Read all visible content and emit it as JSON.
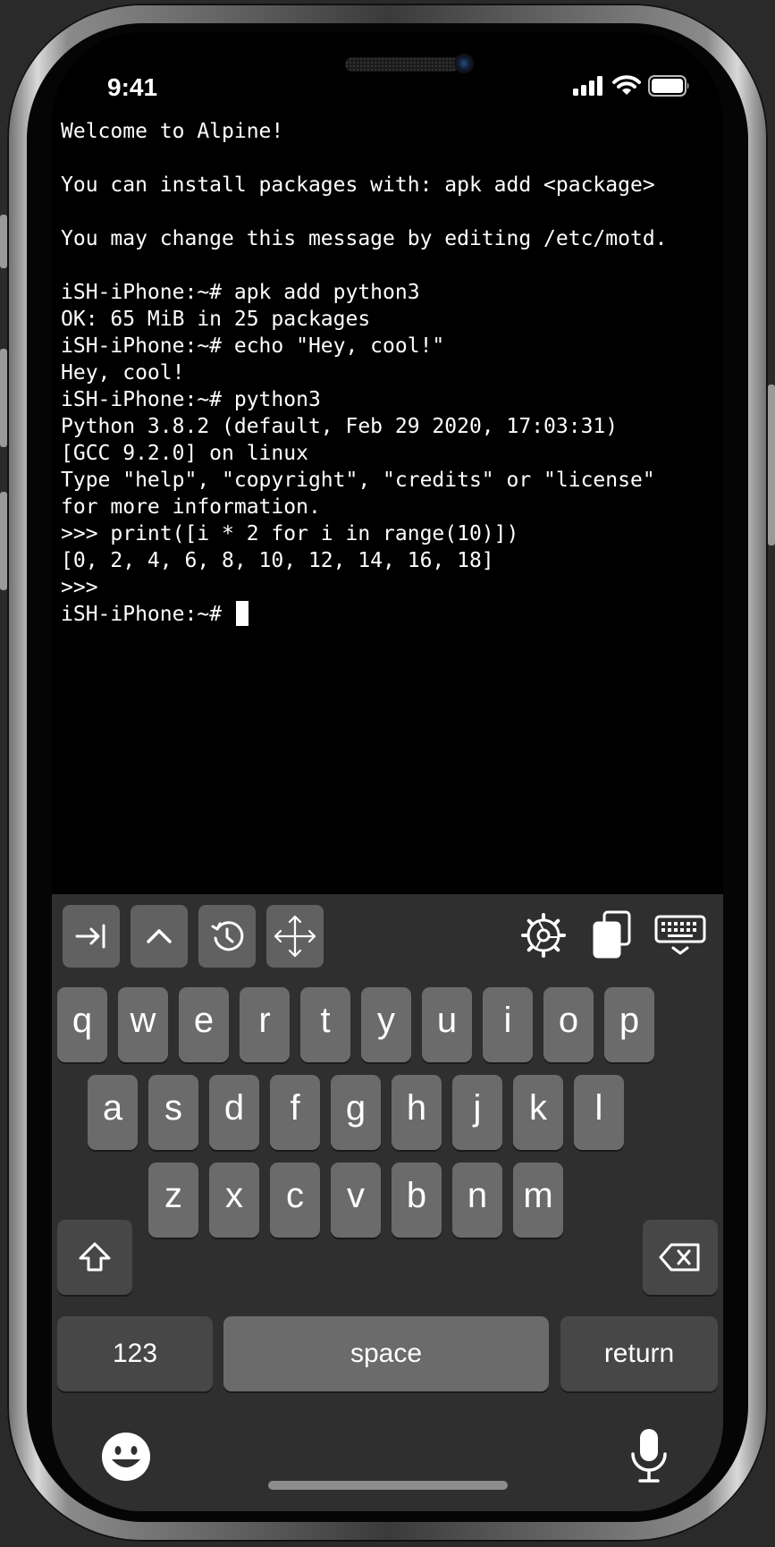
{
  "status_bar": {
    "time": "9:41",
    "icons": [
      "cellular-signal-icon",
      "wifi-icon",
      "battery-icon"
    ]
  },
  "terminal": {
    "lines": [
      "Welcome to Alpine!",
      "",
      "You can install packages with: apk add <package>",
      "",
      "You may change this message by editing /etc/motd.",
      "",
      "iSH-iPhone:~# apk add python3",
      "OK: 65 MiB in 25 packages",
      "iSH-iPhone:~# echo \"Hey, cool!\"",
      "Hey, cool!",
      "iSH-iPhone:~# python3",
      "Python 3.8.2 (default, Feb 29 2020, 17:03:31)",
      "[GCC 9.2.0] on linux",
      "Type \"help\", \"copyright\", \"credits\" or \"license\"",
      "for more information.",
      ">>> print([i * 2 for i in range(10)])",
      "[0, 2, 4, 6, 8, 10, 12, 14, 16, 18]",
      ">>>"
    ],
    "prompt": "iSH-iPhone:~# "
  },
  "toolbar": {
    "left_buttons": [
      "tab-icon",
      "control-icon",
      "history-icon",
      "arrow-keys-icon"
    ],
    "right_buttons": [
      "settings-gear-icon",
      "paste-icon",
      "hide-keyboard-icon"
    ]
  },
  "keyboard": {
    "row1": [
      "q",
      "w",
      "e",
      "r",
      "t",
      "y",
      "u",
      "i",
      "o",
      "p"
    ],
    "row2": [
      "a",
      "s",
      "d",
      "f",
      "g",
      "h",
      "j",
      "k",
      "l"
    ],
    "row3": [
      "z",
      "x",
      "c",
      "v",
      "b",
      "n",
      "m"
    ],
    "numbers_label": "123",
    "space_label": "space",
    "return_label": "return",
    "icons": [
      "shift-icon",
      "backspace-icon",
      "emoji-icon",
      "microphone-icon"
    ]
  },
  "colors": {
    "screen_bg": "#000000",
    "keyboard_bg": "#2f2f2f",
    "key_bg": "#6b6b6b",
    "function_key_bg": "#474747",
    "terminal_text": "#ffffff"
  }
}
